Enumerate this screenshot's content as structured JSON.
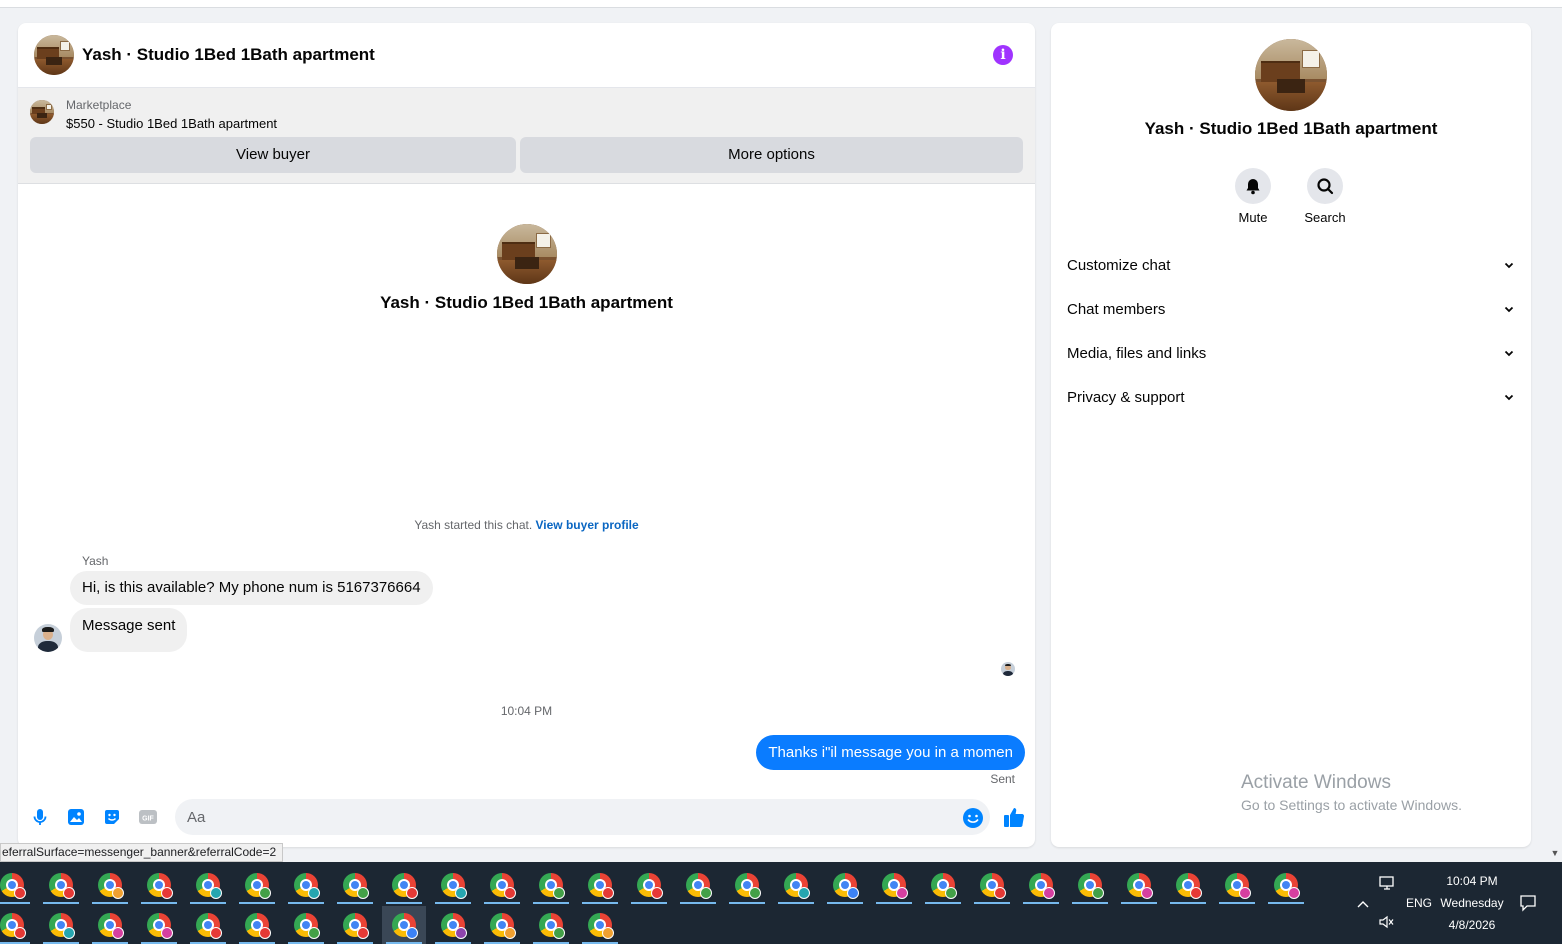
{
  "chat": {
    "title": "Yash · Studio 1Bed 1Bath apartment",
    "marketplace": {
      "label": "Marketplace",
      "listing": "$550 - Studio 1Bed 1Bath apartment",
      "view_buyer": "View buyer",
      "more_options": "More options"
    },
    "intro_title": "Yash · Studio 1Bed 1Bath apartment",
    "started_text": "Yash started this chat.",
    "started_link": "View buyer profile",
    "sender_name": "Yash",
    "messages_in": [
      "Hi, is this available? My phone num is 5167376664",
      "Message sent"
    ],
    "timestamp": "10:04 PM",
    "message_out": "Thanks i\"il message you in a momen",
    "sent_label": "Sent",
    "composer_placeholder": "Aa",
    "gif_label": "GIF"
  },
  "info_panel": {
    "title": "Yash · Studio 1Bed 1Bath apartment",
    "actions": [
      "Mute",
      "Search"
    ],
    "sections": [
      "Customize chat",
      "Chat members",
      "Media, files and links",
      "Privacy & support"
    ]
  },
  "watermark": {
    "title": "Activate Windows",
    "subtitle": "Go to Settings to activate Windows."
  },
  "status_url": "eferralSurface=messenger_banner&referralCode=2",
  "taskbar": {
    "apps_row1": [
      "chrome-icon-red",
      "chrome-icon-red",
      "chrome-icon-orange",
      "chrome-icon-red",
      "chrome-icon-teal",
      "chrome-icon-green",
      "chrome-icon-teal",
      "chrome-icon-green",
      "chrome-icon-red",
      "chrome-icon-teal",
      "chrome-icon-red",
      "chrome-icon-green",
      "chrome-icon-red",
      "chrome-icon-red",
      "chrome-icon-green",
      "chrome-icon-green",
      "chrome-icon-teal",
      "chrome-icon-blue",
      "chrome-icon-pink",
      "chrome-icon-green",
      "chrome-icon-red",
      "chrome-icon-pink",
      "chrome-icon-green",
      "chrome-icon-pink",
      "chrome-icon-red",
      "chrome-icon-pink",
      "chrome-icon-pink"
    ],
    "apps_row2": [
      "chrome-icon-red",
      "chrome-icon-teal",
      "chrome-icon-pink",
      "chrome-icon-pink",
      "chrome-icon-red",
      "chrome-icon-red",
      "chrome-icon-green",
      "chrome-icon-red",
      "chrome-icon-blue",
      "chrome-icon-purple",
      "chrome-icon-orange",
      "chrome-icon-green",
      "chrome-icon-orange"
    ],
    "language": "ENG",
    "time": "10:04 PM",
    "day": "Wednesday",
    "date": "4/8/2026"
  },
  "colors": {
    "accent": "#0a7cff",
    "info_icon": "#a033ff",
    "link": "#0a66c2",
    "taskbar": "#1c2733"
  }
}
